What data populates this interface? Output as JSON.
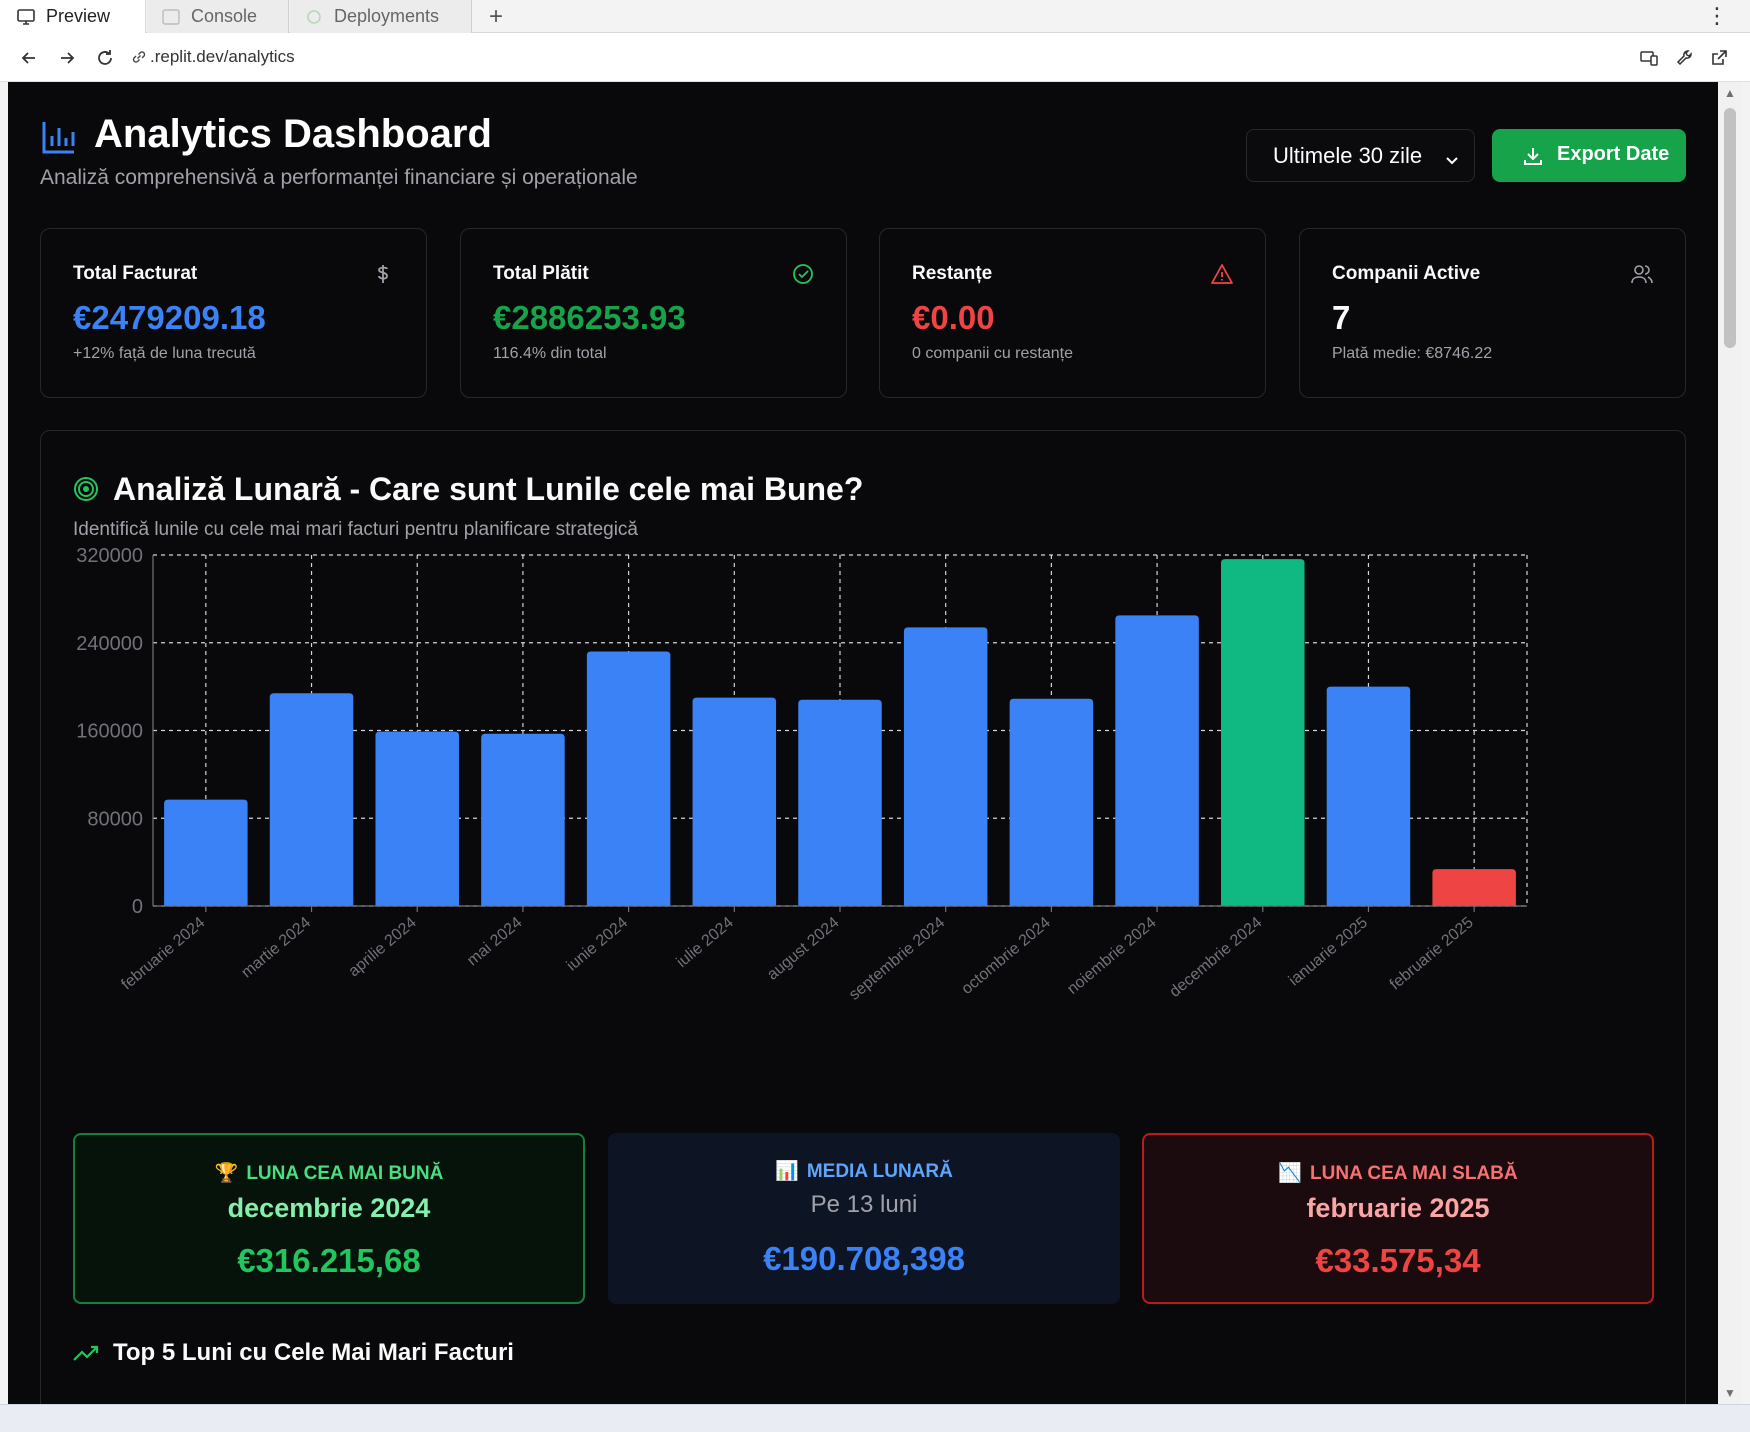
{
  "browser": {
    "tabs": [
      {
        "label": "Preview",
        "icon": "monitor-icon",
        "active": true
      },
      {
        "label": "Console",
        "icon": "terminal-icon",
        "active": false
      },
      {
        "label": "Deployments",
        "icon": "deploy-icon",
        "active": false
      }
    ],
    "url": ".replit.dev/analytics"
  },
  "header": {
    "title": "Analytics Dashboard",
    "subtitle": "Analiză comprehensivă a performanței financiare și operaționale",
    "period_select": "Ultimele 30 zile",
    "export_label": "Export Date"
  },
  "stats": [
    {
      "label": "Total Facturat",
      "value": "€2479209.18",
      "sub": "+12% față de luna trecută",
      "color": "#3b82f6",
      "icon": "dollar-icon"
    },
    {
      "label": "Total Plătit",
      "value": "€2886253.93",
      "sub": "116.4% din total",
      "color": "#22c55e",
      "icon": "check-circle-icon"
    },
    {
      "label": "Restanțe",
      "value": "€0.00",
      "sub": "0 companii cu restanțe",
      "color": "#ef4444",
      "icon": "alert-triangle-icon"
    },
    {
      "label": "Companii Active",
      "value": "7",
      "sub": "Plată medie: €8746.22",
      "color": "#fafafa",
      "icon": "users-icon"
    }
  ],
  "monthly": {
    "title": "Analiză Lunară - Care sunt Lunile cele mai Bune?",
    "subtitle": "Identifică lunile cu cele mai mari facturi pentru planificare strategică",
    "best": {
      "label": "LUNA CEA MAI BUNĂ",
      "emoji": "🏆",
      "month": "decembrie 2024",
      "value": "€316.215,68"
    },
    "average": {
      "label": "MEDIA LUNARĂ",
      "emoji": "📊",
      "note": "Pe 13 luni",
      "value": "€190.708,398"
    },
    "worst": {
      "label": "LUNA CEA MAI SLABĂ",
      "emoji": "📉",
      "month": "februarie 2025",
      "value": "€33.575,34"
    },
    "top5_title": "Top 5 Luni cu Cele Mai Mari Facturi"
  },
  "chart_data": {
    "type": "bar",
    "categories": [
      "februarie 2024",
      "martie 2024",
      "aprilie 2024",
      "mai 2024",
      "iunie 2024",
      "iulie 2024",
      "august 2024",
      "septembrie 2024",
      "octombrie 2024",
      "noiembrie 2024",
      "decembrie 2024",
      "ianuarie 2025",
      "februarie 2025"
    ],
    "values": [
      97000,
      194000,
      159000,
      157000,
      232000,
      190000,
      188000,
      254000,
      189000,
      265000,
      316215.68,
      200000,
      33575.34
    ],
    "ylim": [
      0,
      320000
    ],
    "yticks": [
      0,
      80000,
      160000,
      240000,
      320000
    ],
    "grid": true,
    "colors": {
      "default": "#3b82f6",
      "best": "#10b981",
      "worst": "#ef4444"
    }
  }
}
